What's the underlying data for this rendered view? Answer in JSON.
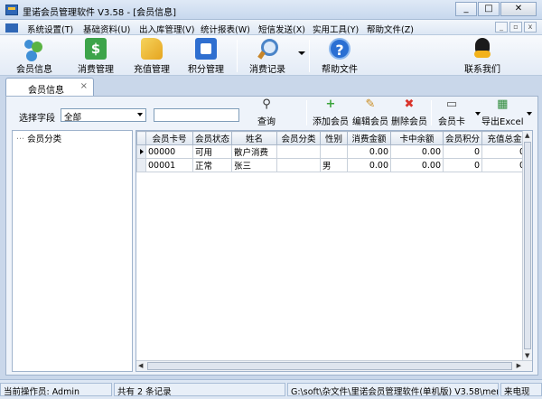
{
  "window": {
    "title": "里诺会员管理软件 V3.58 - [会员信息]"
  },
  "menu": {
    "items": [
      "系统设置(T)",
      "基础资料(U)",
      "出入库管理(V)",
      "统计报表(W)",
      "短信发送(X)",
      "实用工具(Y)",
      "帮助文件(Z)"
    ]
  },
  "toolbar": {
    "buttons": [
      {
        "label": "会员信息",
        "icon": "members-icon"
      },
      {
        "label": "消费管理",
        "icon": "money-icon"
      },
      {
        "label": "充值管理",
        "icon": "tag-icon"
      },
      {
        "label": "积分管理",
        "icon": "points-icon"
      },
      {
        "label": "消费记录",
        "icon": "search-doc-icon"
      },
      {
        "label": "帮助文件",
        "icon": "help-icon"
      },
      {
        "label": "联系我们",
        "icon": "qq-icon"
      }
    ]
  },
  "doctab": {
    "label": "会员信息",
    "close": "×"
  },
  "filter": {
    "label": "选择字段",
    "selected": "全部",
    "search_value": ""
  },
  "actions": {
    "query": "查询",
    "add": "添加会员",
    "edit": "编辑会员",
    "delete": "删除会员",
    "card": "会员卡",
    "export": "导出Excel"
  },
  "tree": {
    "root": "会员分类"
  },
  "table": {
    "columns": [
      "会员卡号",
      "会员状态",
      "姓名",
      "会员分类",
      "性别",
      "消费金额",
      "卡中余额",
      "会员积分",
      "充值总金"
    ],
    "rows": [
      [
        "00000",
        "可用",
        "散户消费",
        "",
        "",
        "0.00",
        "0.00",
        "0",
        "0"
      ],
      [
        "00001",
        "正常",
        "张三",
        "",
        "男",
        "0.00",
        "0.00",
        "0",
        "0"
      ]
    ]
  },
  "status": {
    "operator": "当前操作员: Admin",
    "count": "共有 2 条记录",
    "path": "G:\\soft\\杂文件\\里诺会员管理软件(单机版) V3.58\\mem",
    "extra": "来电现"
  }
}
